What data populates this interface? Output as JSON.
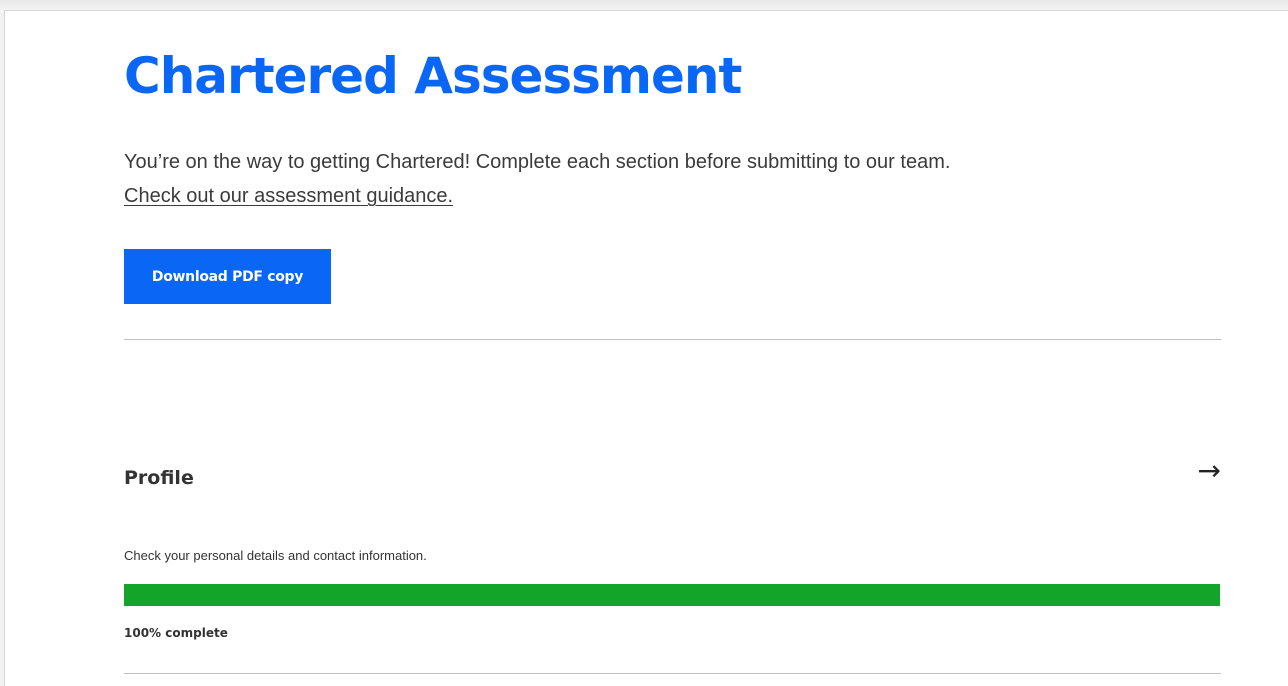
{
  "page": {
    "title": "Chartered Assessment",
    "intro_text": "You’re on the way to getting Chartered! Complete each section before submitting to our team.",
    "guidance_link": "Check out our assessment guidance.",
    "download_button": "Download PDF copy"
  },
  "sections": [
    {
      "title": "Profile",
      "description": "Check your personal details and contact information.",
      "progress_percent": 100,
      "progress_label": "100% complete",
      "arrow_icon": "arrow-right-icon"
    }
  ],
  "colors": {
    "brand_blue": "#0a66f5",
    "progress_green": "#13a42a"
  }
}
